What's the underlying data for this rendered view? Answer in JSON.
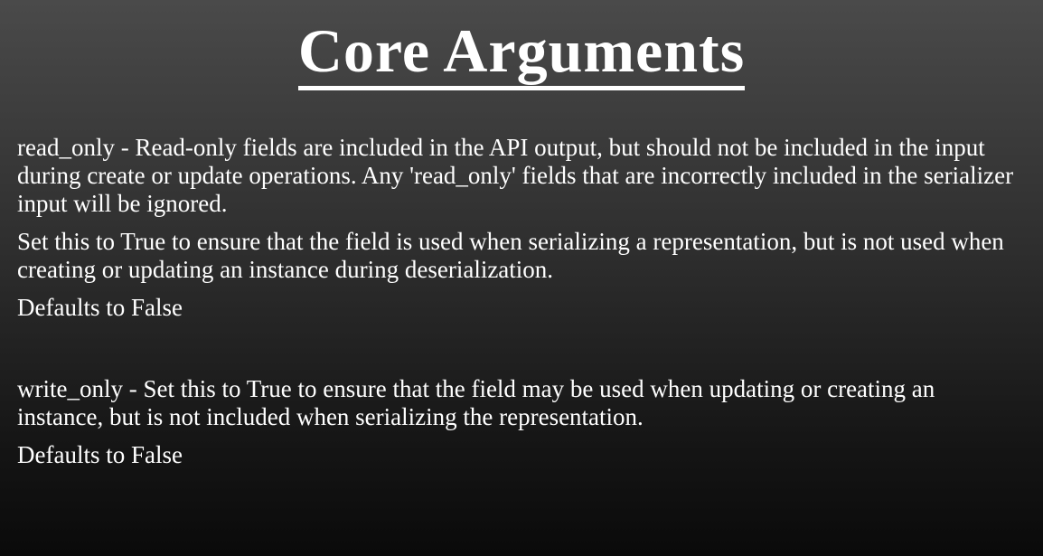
{
  "slide": {
    "title": "Core Arguments",
    "sections": [
      {
        "paragraphs": [
          "read_only - Read-only fields are included in the API output, but should not be included in the input during create or update operations. Any 'read_only' fields that are incorrectly included in the serializer input will be ignored.",
          "Set this to True to ensure that the field is used when serializing a representation, but is not used when creating or updating an instance during deserialization.",
          "Defaults to False"
        ]
      },
      {
        "paragraphs": [
          "write_only - Set this to True to ensure that the field may be used when updating or creating an instance, but is not included when serializing the representation.",
          "Defaults to False"
        ]
      }
    ]
  }
}
